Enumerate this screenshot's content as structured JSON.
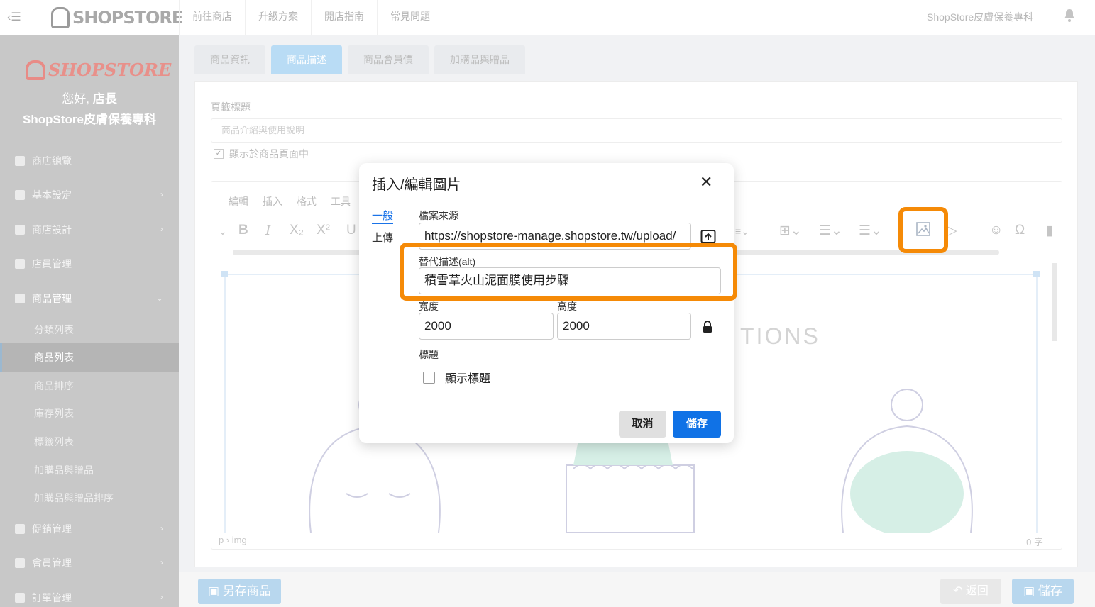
{
  "topbar": {
    "logo_text": "SHOPSTORE",
    "nav": [
      "前往商店",
      "升級方案",
      "開店指南",
      "常見問題"
    ],
    "shop_name": "ShopStore皮膚保養專科"
  },
  "sidebar": {
    "logo_text": "SHOPSTORE",
    "greeting_prefix": "您好,",
    "greeting_name": "店長",
    "shop_name": "ShopStore皮膚保養專科",
    "items": [
      {
        "label": "商店總覽",
        "icon": "dashboard-icon"
      },
      {
        "label": "基本設定",
        "icon": "bank-icon"
      },
      {
        "label": "商店設計",
        "icon": "brush-icon"
      },
      {
        "label": "店員管理",
        "icon": "lock-icon"
      },
      {
        "label": "商品管理",
        "icon": "cart-icon"
      }
    ],
    "sub_items": [
      "分類列表",
      "商品列表",
      "商品排序",
      "庫存列表",
      "標籤列表",
      "加購品與贈品",
      "加購品與贈品排序"
    ],
    "bottom_items": [
      {
        "label": "促銷管理",
        "icon": "gift-icon"
      },
      {
        "label": "會員管理",
        "icon": "users-icon"
      },
      {
        "label": "訂單管理",
        "icon": "order-icon"
      }
    ]
  },
  "tabs": [
    "商品資訊",
    "商品描述",
    "商品會員價",
    "加購品與贈品"
  ],
  "panel": {
    "title_label": "頁籤標題",
    "title_placeholder": "商品介紹與使用說明",
    "show_label": "顯示於商品頁面中"
  },
  "editor": {
    "menus": [
      "編輯",
      "插入",
      "格式",
      "工具"
    ],
    "content_heading": "TIONS",
    "path": "p › img",
    "word_count": "0 字"
  },
  "dialog": {
    "title": "插入/編輯圖片",
    "tabs": [
      "一般",
      "上傳"
    ],
    "source_label": "檔案來源",
    "source_value": "https://shopstore-manage.shopstore.tw/upload/",
    "alt_label": "替代描述(alt)",
    "alt_value": "積雪草火山泥面膜使用步驟",
    "width_label": "寬度",
    "width_value": "2000",
    "height_label": "高度",
    "height_value": "2000",
    "caption_label": "標題",
    "caption_check_label": "顯示標題",
    "cancel_label": "取消",
    "save_label": "儲存"
  },
  "footer": {
    "saveas_label": "另存商品",
    "back_label": "返回",
    "save_label": "儲存"
  },
  "colors": {
    "highlight": "#f58a07",
    "primary": "#1072e6"
  }
}
